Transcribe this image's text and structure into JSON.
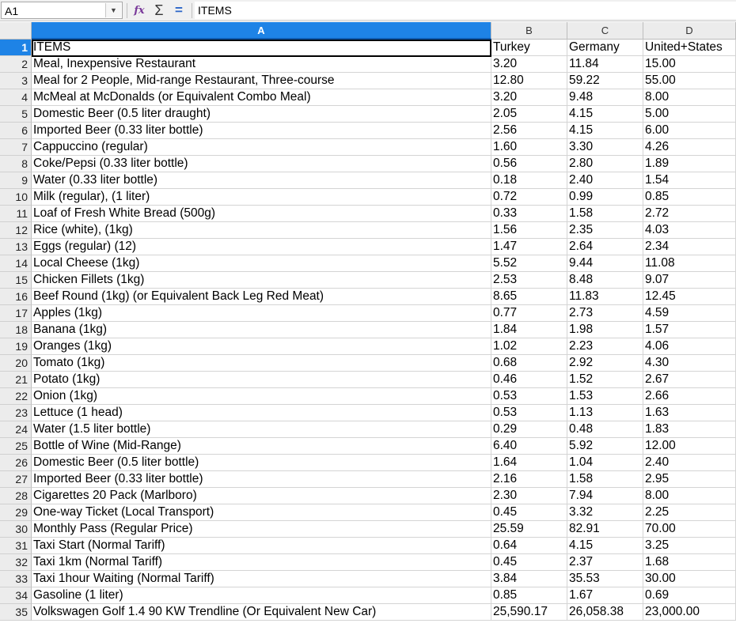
{
  "formula_bar": {
    "name_box": "A1",
    "formula": "ITEMS"
  },
  "columns": [
    "A",
    "B",
    "C",
    "D"
  ],
  "selected_column": "A",
  "active_cell": "A1",
  "colors": {
    "selection": "#1e83e6",
    "header": "#ececec"
  },
  "rows": [
    {
      "n": "1",
      "cells": [
        "ITEMS",
        "Turkey",
        "Germany",
        "United+States"
      ]
    },
    {
      "n": "2",
      "cells": [
        "Meal, Inexpensive Restaurant",
        "3.20",
        "11.84",
        "15.00"
      ]
    },
    {
      "n": "3",
      "cells": [
        "Meal for 2 People, Mid-range Restaurant, Three-course",
        "12.80",
        "59.22",
        "55.00"
      ]
    },
    {
      "n": "4",
      "cells": [
        "McMeal at McDonalds (or Equivalent Combo Meal)",
        "3.20",
        "9.48",
        "8.00"
      ]
    },
    {
      "n": "5",
      "cells": [
        "Domestic Beer (0.5 liter draught)",
        "2.05",
        "4.15",
        "5.00"
      ]
    },
    {
      "n": "6",
      "cells": [
        "Imported Beer (0.33 liter bottle)",
        "2.56",
        "4.15",
        "6.00"
      ]
    },
    {
      "n": "7",
      "cells": [
        "Cappuccino (regular)",
        "1.60",
        "3.30",
        "4.26"
      ]
    },
    {
      "n": "8",
      "cells": [
        "Coke/Pepsi (0.33 liter bottle)",
        "0.56",
        "2.80",
        "1.89"
      ]
    },
    {
      "n": "9",
      "cells": [
        "Water (0.33 liter bottle)",
        "0.18",
        "2.40",
        "1.54"
      ]
    },
    {
      "n": "10",
      "cells": [
        "Milk (regular), (1 liter)",
        "0.72",
        "0.99",
        "0.85"
      ]
    },
    {
      "n": "11",
      "cells": [
        "Loaf of Fresh White Bread (500g)",
        "0.33",
        "1.58",
        "2.72"
      ]
    },
    {
      "n": "12",
      "cells": [
        "Rice (white), (1kg)",
        "1.56",
        "2.35",
        "4.03"
      ]
    },
    {
      "n": "13",
      "cells": [
        "Eggs (regular) (12)",
        "1.47",
        "2.64",
        "2.34"
      ]
    },
    {
      "n": "14",
      "cells": [
        "Local Cheese (1kg)",
        "5.52",
        "9.44",
        "11.08"
      ]
    },
    {
      "n": "15",
      "cells": [
        "Chicken Fillets (1kg)",
        "2.53",
        "8.48",
        "9.07"
      ]
    },
    {
      "n": "16",
      "cells": [
        "Beef Round (1kg) (or Equivalent Back Leg Red Meat)",
        "8.65",
        "11.83",
        "12.45"
      ]
    },
    {
      "n": "17",
      "cells": [
        "Apples (1kg)",
        "0.77",
        "2.73",
        "4.59"
      ]
    },
    {
      "n": "18",
      "cells": [
        "Banana (1kg)",
        "1.84",
        "1.98",
        "1.57"
      ]
    },
    {
      "n": "19",
      "cells": [
        "Oranges (1kg)",
        "1.02",
        "2.23",
        "4.06"
      ]
    },
    {
      "n": "20",
      "cells": [
        "Tomato (1kg)",
        "0.68",
        "2.92",
        "4.30"
      ]
    },
    {
      "n": "21",
      "cells": [
        "Potato (1kg)",
        "0.46",
        "1.52",
        "2.67"
      ]
    },
    {
      "n": "22",
      "cells": [
        "Onion (1kg)",
        "0.53",
        "1.53",
        "2.66"
      ]
    },
    {
      "n": "23",
      "cells": [
        "Lettuce (1 head)",
        "0.53",
        "1.13",
        "1.63"
      ]
    },
    {
      "n": "24",
      "cells": [
        "Water (1.5 liter bottle)",
        "0.29",
        "0.48",
        "1.83"
      ]
    },
    {
      "n": "25",
      "cells": [
        "Bottle of Wine (Mid-Range)",
        "6.40",
        "5.92",
        "12.00"
      ]
    },
    {
      "n": "26",
      "cells": [
        "Domestic Beer (0.5 liter bottle)",
        "1.64",
        "1.04",
        "2.40"
      ]
    },
    {
      "n": "27",
      "cells": [
        "Imported Beer (0.33 liter bottle)",
        "2.16",
        "1.58",
        "2.95"
      ]
    },
    {
      "n": "28",
      "cells": [
        "Cigarettes 20 Pack (Marlboro)",
        "2.30",
        "7.94",
        "8.00"
      ]
    },
    {
      "n": "29",
      "cells": [
        "One-way Ticket (Local Transport)",
        "0.45",
        "3.32",
        "2.25"
      ]
    },
    {
      "n": "30",
      "cells": [
        "Monthly Pass (Regular Price)",
        "25.59",
        "82.91",
        "70.00"
      ]
    },
    {
      "n": "31",
      "cells": [
        "Taxi Start (Normal Tariff)",
        "0.64",
        "4.15",
        "3.25"
      ]
    },
    {
      "n": "32",
      "cells": [
        "Taxi 1km (Normal Tariff)",
        "0.45",
        "2.37",
        "1.68"
      ]
    },
    {
      "n": "33",
      "cells": [
        "Taxi 1hour Waiting (Normal Tariff)",
        "3.84",
        "35.53",
        "30.00"
      ]
    },
    {
      "n": "34",
      "cells": [
        "Gasoline (1 liter)",
        "0.85",
        "1.67",
        "0.69"
      ]
    },
    {
      "n": "35",
      "cells": [
        "Volkswagen Golf 1.4 90 KW Trendline (Or Equivalent New Car)",
        "25,590.17",
        "26,058.38",
        "23,000.00"
      ]
    }
  ]
}
